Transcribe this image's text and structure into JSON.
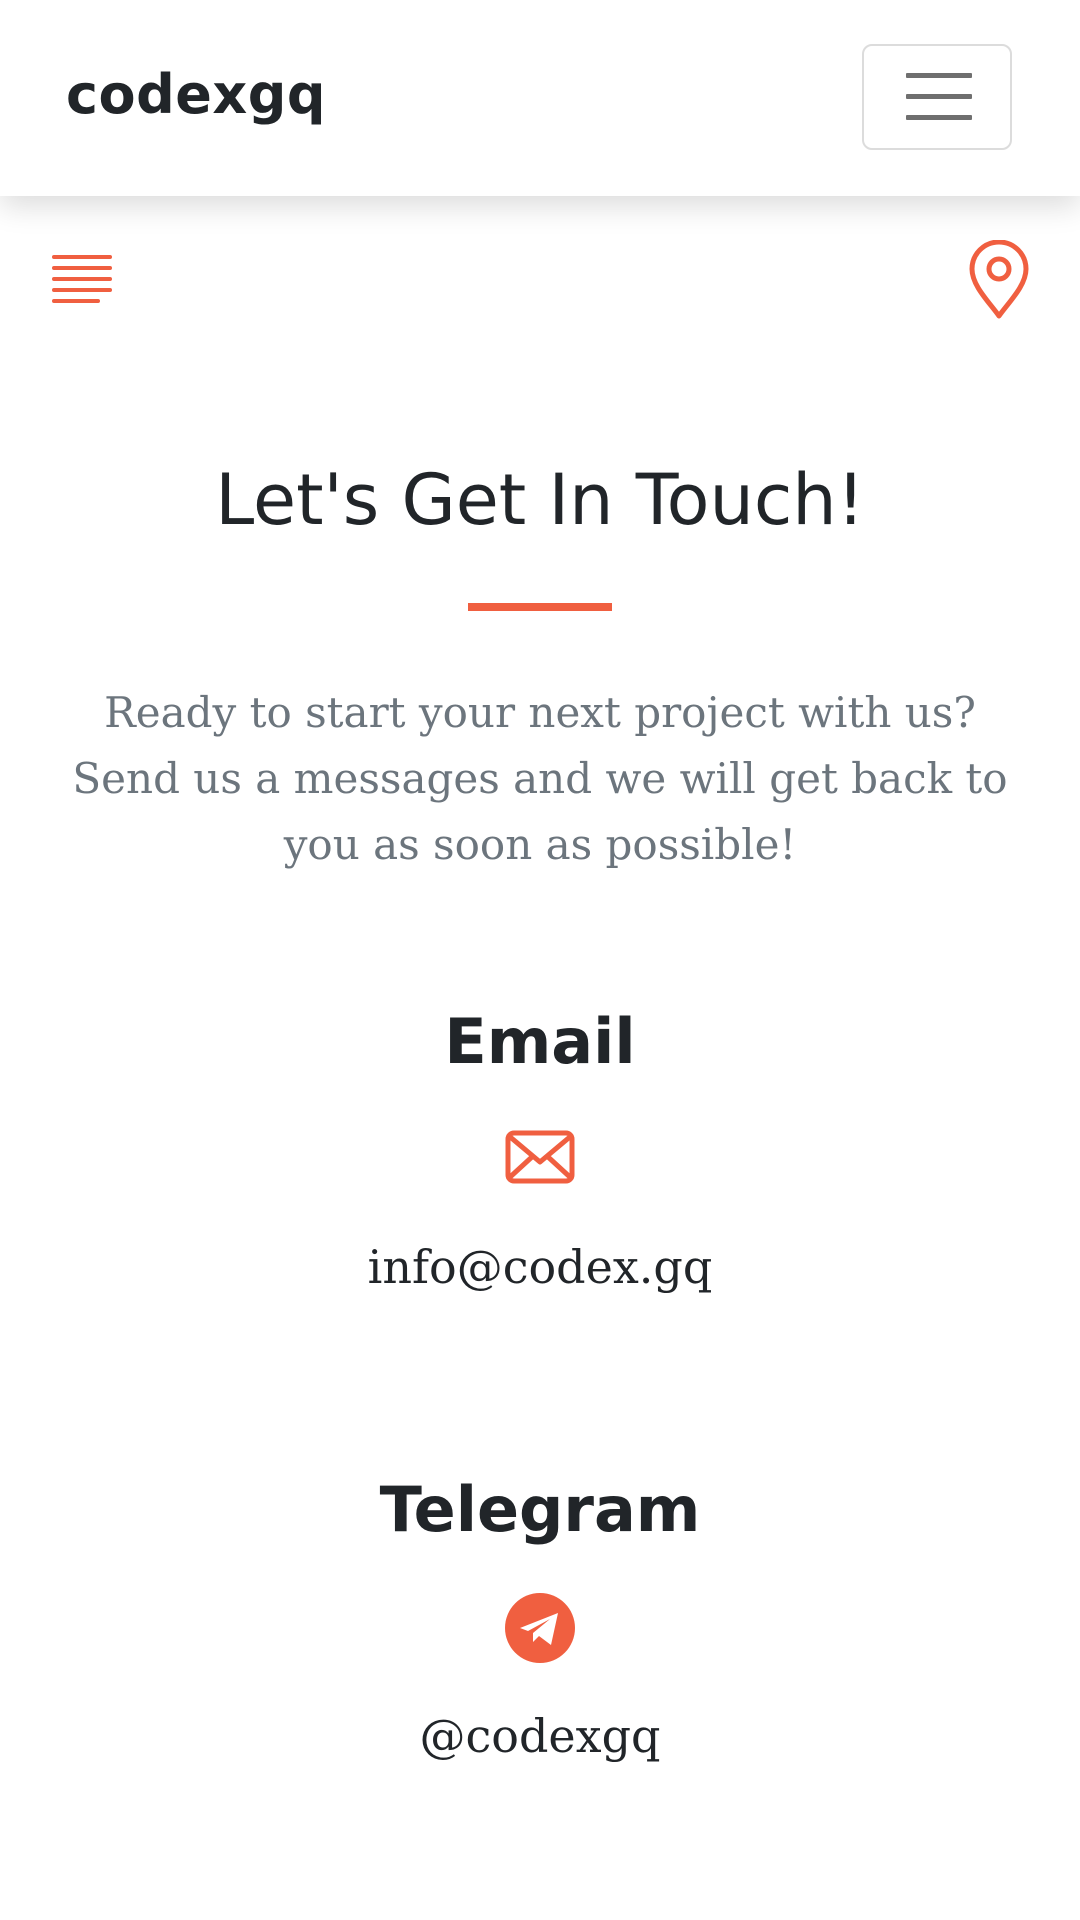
{
  "navbar": {
    "brand": "codexgq",
    "toggler_icon": "hamburger-icon"
  },
  "toolbar": {
    "menu_icon": "list-lines-icon",
    "location_icon": "map-pin-icon"
  },
  "contact": {
    "heading": "Let's Get In Touch!",
    "lead": "Ready to start your next project with us? Send us a messages and we will get back to you as soon as possible!",
    "email": {
      "title": "Email",
      "icon": "envelope-icon",
      "value": "info@codex.gq"
    },
    "telegram": {
      "title": "Telegram",
      "icon": "telegram-icon",
      "value": "@codexgq"
    }
  },
  "colors": {
    "accent": "#f05f40",
    "text": "#212529",
    "muted": "#6c757d"
  }
}
